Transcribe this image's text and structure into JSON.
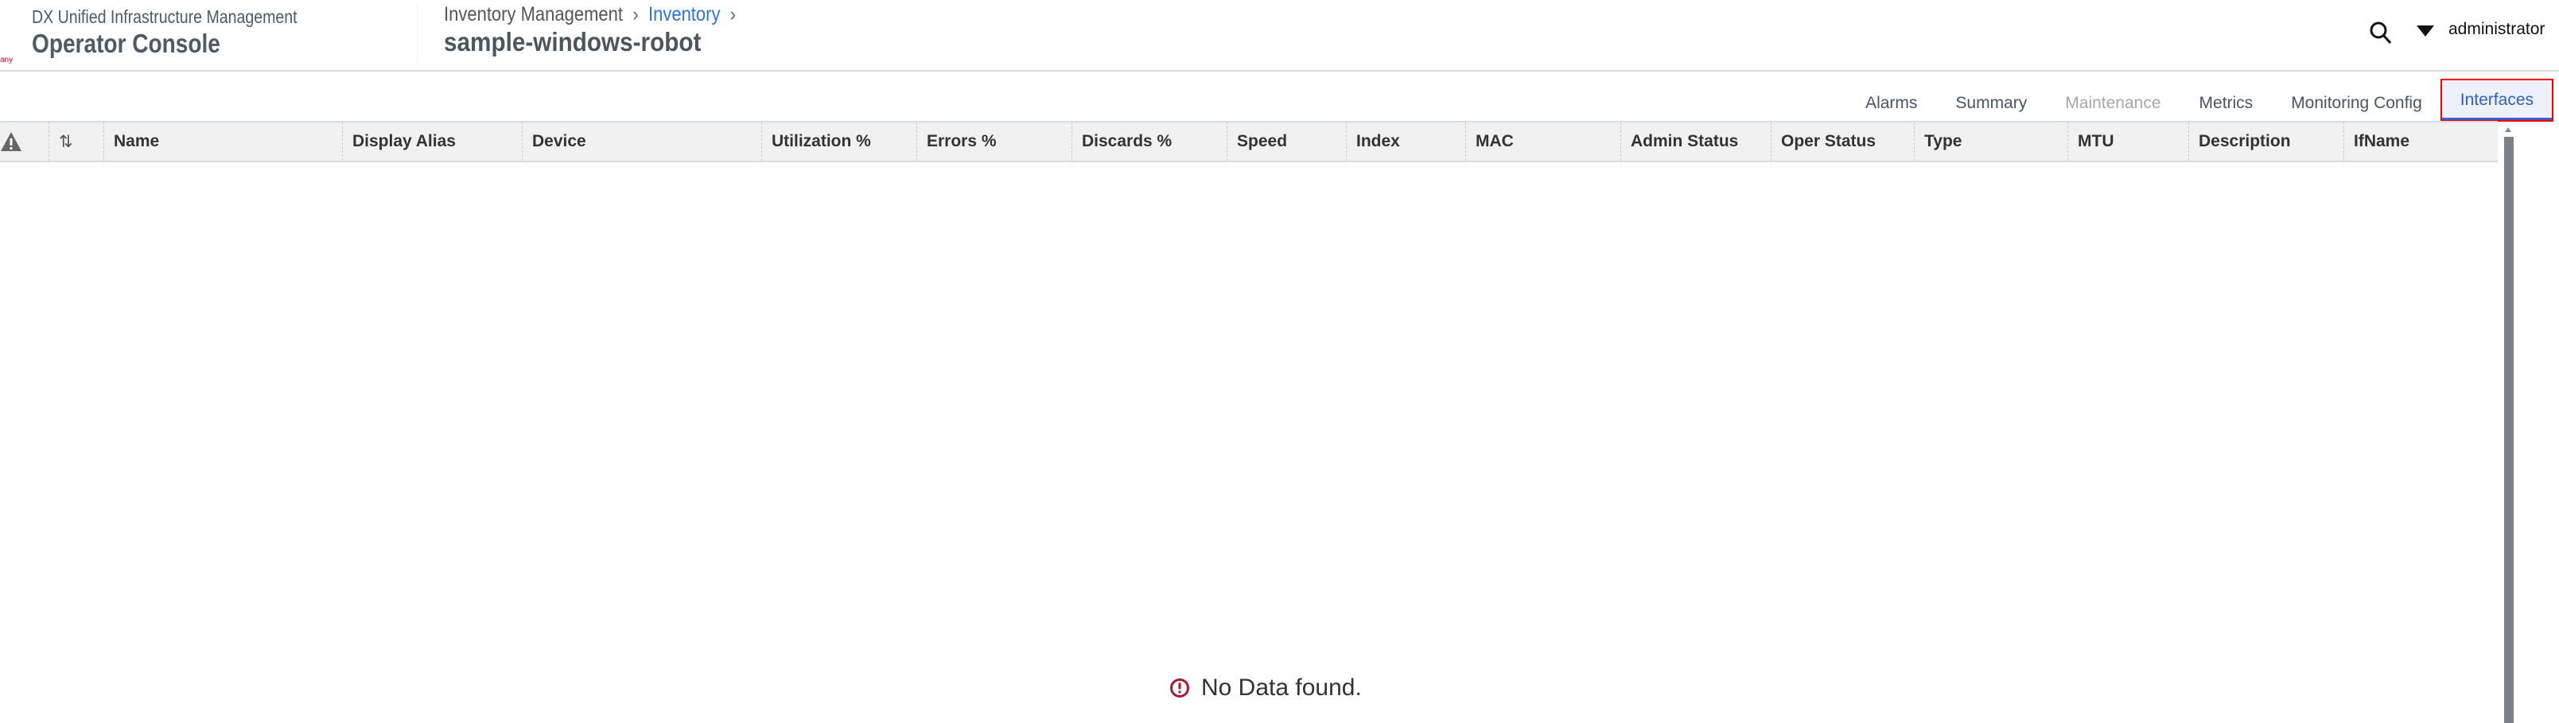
{
  "header": {
    "logo_fragment": "any",
    "suite": "DX Unified Infrastructure Management",
    "app": "Operator Console",
    "breadcrumb": [
      "Inventory Management",
      "Inventory"
    ],
    "title": "sample-windows-robot",
    "user": "administrator"
  },
  "tabs": [
    {
      "label": "Alarms"
    },
    {
      "label": "Summary"
    },
    {
      "label": "Maintenance",
      "disabled": true
    },
    {
      "label": "Metrics"
    },
    {
      "label": "Monitoring Config"
    },
    {
      "label": "Interfaces",
      "active": true
    }
  ],
  "table": {
    "columns": [
      "Name",
      "Display Alias",
      "Device",
      "Utilization %",
      "Errors %",
      "Discards %",
      "Speed",
      "Index",
      "MAC",
      "Admin Status",
      "Oper Status",
      "Type",
      "MTU",
      "Description",
      "IfName"
    ]
  },
  "empty_message": "No Data found.",
  "colors": {
    "accent": "#2d5fc4",
    "link": "#2d74da",
    "error": "#a8192e"
  }
}
